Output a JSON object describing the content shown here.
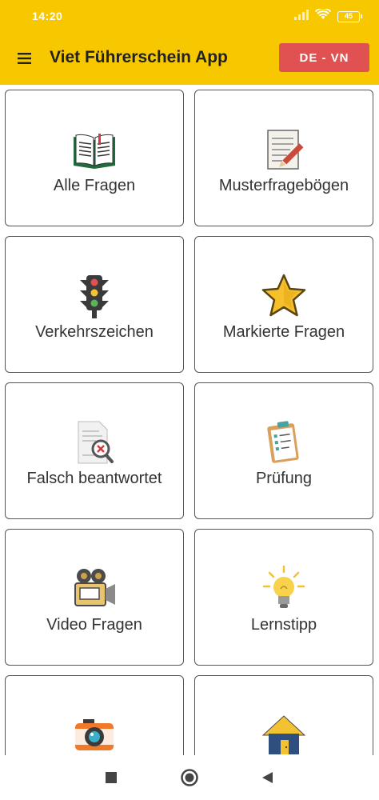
{
  "status_bar": {
    "time": "14:20",
    "battery": "45"
  },
  "app_bar": {
    "title": "Viet Führerschein App",
    "menu_icon": "hamburger-menu-icon",
    "lang_button_label": "DE - VN"
  },
  "menu": [
    {
      "label": "Alle Fragen",
      "icon": "open-book-icon"
    },
    {
      "label": "Musterfragebögen",
      "icon": "notepad-pencil-icon"
    },
    {
      "label": "Verkehrszeichen",
      "icon": "traffic-light-icon"
    },
    {
      "label": "Markierte Fragen",
      "icon": "star-icon"
    },
    {
      "label": "Falsch beantwortet",
      "icon": "document-wrong-icon"
    },
    {
      "label": "Prüfung",
      "icon": "clipboard-checklist-icon"
    },
    {
      "label": "Video Fragen",
      "icon": "video-camera-icon"
    },
    {
      "label": "Lernstipp",
      "icon": "lightbulb-icon"
    },
    {
      "label": "",
      "icon": "photo-camera-icon"
    },
    {
      "label": "",
      "icon": "house-icon"
    }
  ],
  "colors": {
    "app_bar": "#f7c800",
    "lang_button": "#e05252",
    "card_border": "#555555"
  },
  "nav_bar": {
    "icons": [
      "square-recents-icon",
      "circle-home-icon",
      "triangle-back-icon"
    ]
  }
}
